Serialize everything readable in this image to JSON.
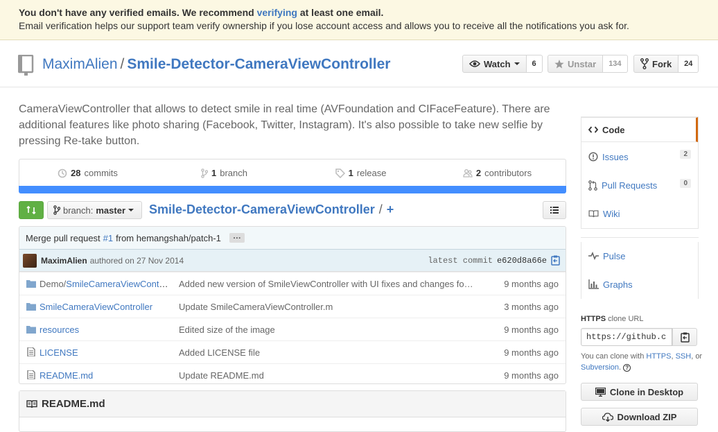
{
  "flash": {
    "line1_prefix": "You don't have any verified emails. We recommend ",
    "line1_link": "verifying",
    "line1_suffix": " at least one email.",
    "line2": "Email verification helps our support team verify ownership if you lose account access and allows you to receive all the notifications you ask for."
  },
  "repo": {
    "owner": "MaximAlien",
    "separator": "/",
    "name": "Smile-Detector-CameraViewController",
    "description": "CameraViewController that allows to detect smile in real time (AVFoundation and CIFaceFeature). There are additional features like photo sharing (Facebook, Twitter, Instagram). It's also possible to take new selfie by pressing Re-take button."
  },
  "actions": {
    "watch_label": "Watch",
    "watch_count": "6",
    "unstar_label": "Unstar",
    "star_count": "134",
    "fork_label": "Fork",
    "fork_count": "24"
  },
  "summary": {
    "commits_num": "28",
    "commits_label": "commits",
    "branch_num": "1",
    "branch_label": "branch",
    "release_num": "1",
    "release_label": "release",
    "contributors_num": "2",
    "contributors_label": "contributors"
  },
  "langbar_color": "#438eff",
  "filenav": {
    "branch_prefix": "branch:",
    "branch_name": "master",
    "breadcrumb_repo": "Smile-Detector-CameraViewController",
    "breadcrumb_sep": "/",
    "breadcrumb_plus": "+"
  },
  "latest_commit": {
    "msg_prefix": "Merge pull request ",
    "pr_link": "#1",
    "msg_suffix": " from hemangshah/patch-1",
    "ellipsis": "…",
    "author": "MaximAlien",
    "authored": "authored on 27 Nov 2014",
    "sha_label": "latest commit",
    "sha": "e620d8a66e"
  },
  "files": [
    {
      "prefix": "Demo/",
      "name": "SmileCameraViewController",
      "type": "dir",
      "message": "Added new version of SmileViewController with UI fixes and changes fo…",
      "age": "9 months ago"
    },
    {
      "prefix": "",
      "name": "SmileCameraViewController",
      "type": "dir",
      "message": "Update SmileCameraViewController.m",
      "age": "3 months ago"
    },
    {
      "prefix": "",
      "name": "resources",
      "type": "dir",
      "message": "Edited size of the image",
      "age": "9 months ago"
    },
    {
      "prefix": "",
      "name": "LICENSE",
      "type": "file",
      "message": "Added LICENSE file",
      "age": "9 months ago"
    },
    {
      "prefix": "",
      "name": "README.md",
      "type": "file",
      "message": "Update README.md",
      "age": "9 months ago"
    }
  ],
  "readme": {
    "title": "README.md"
  },
  "sidebar": {
    "code": "Code",
    "issues": "Issues",
    "issues_count": "2",
    "pulls": "Pull Requests",
    "pulls_count": "0",
    "wiki": "Wiki",
    "pulse": "Pulse",
    "graphs": "Graphs"
  },
  "clone": {
    "protocol": "HTTPS",
    "label": "clone URL",
    "url": "https://github.com/MaximAlien/Smile-Detector-CameraViewController.git",
    "help_prefix": "You can clone with ",
    "https": "HTTPS",
    "comma": ", ",
    "ssh": "SSH",
    "or": ", or ",
    "subversion": "Subversion",
    "period": ".",
    "help_icon": "?",
    "desktop_button": "Clone in Desktop",
    "zip_button": "Download ZIP"
  }
}
